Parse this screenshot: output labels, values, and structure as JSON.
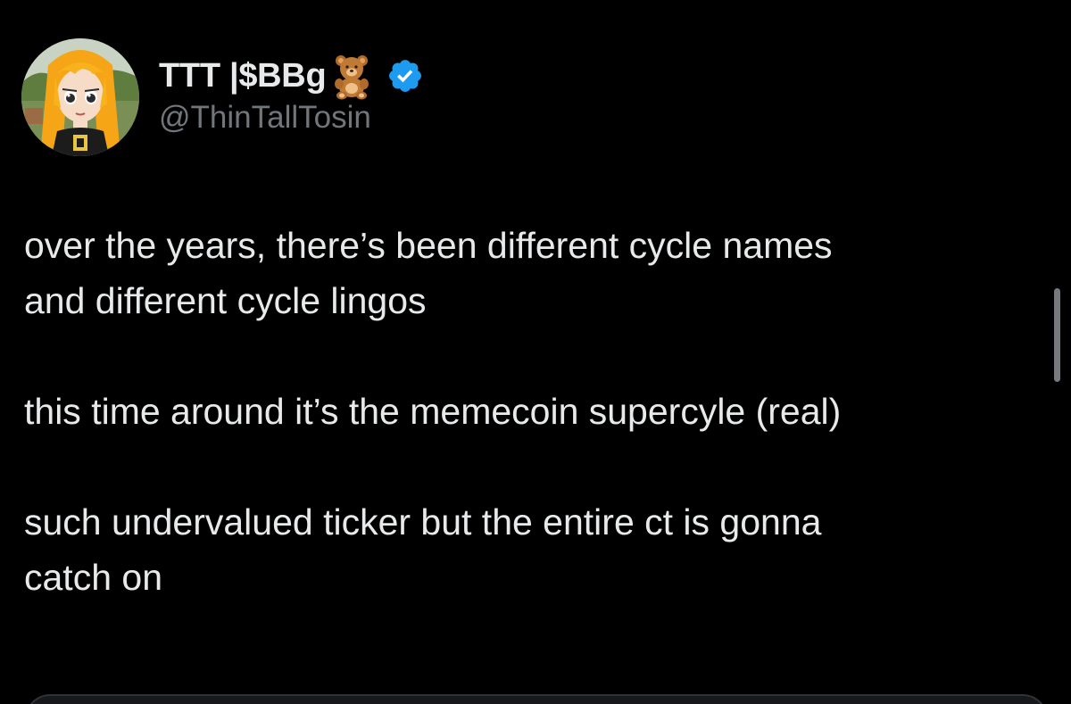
{
  "author": {
    "display_name": "TTT |$BBg",
    "name_emoji": "teddy-bear-icon",
    "verified": true,
    "handle": "@ThinTallTosin",
    "avatar": "avatar"
  },
  "tweet": {
    "paragraphs": [
      "over the years, there’s been different cycle names\nand different cycle lingos",
      "this time around it’s the memecoin supercyle (real)",
      "such undervalued ticker but the entire ct is gonna\ncatch on"
    ]
  },
  "colors": {
    "background": "#000000",
    "text": "#e7e9ea",
    "secondary_text": "#71767b",
    "verified_blue": "#1d9bf0"
  }
}
